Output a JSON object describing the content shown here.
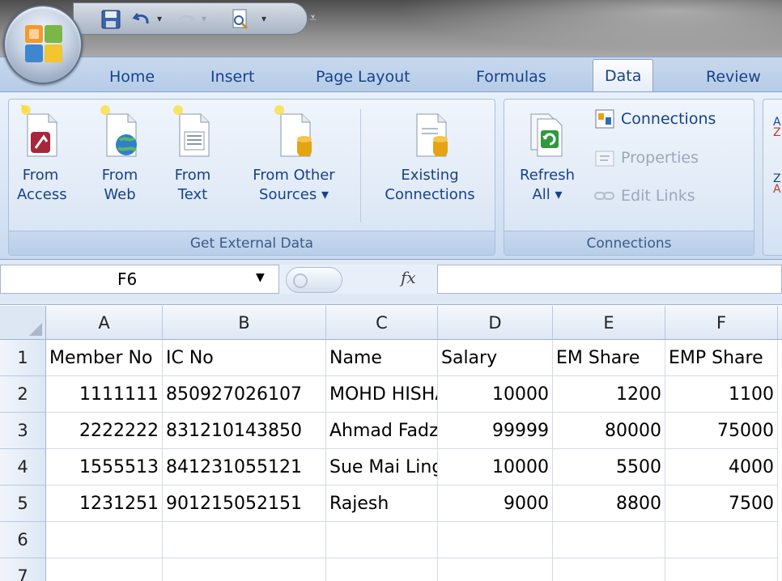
{
  "tabs": [
    "Home",
    "Insert",
    "Page Layout",
    "Formulas",
    "Data",
    "Review"
  ],
  "active_tab": "Data",
  "ribbon": {
    "get_external_data": {
      "label": "Get External Data",
      "buttons": [
        {
          "line1": "From",
          "line2": "Access"
        },
        {
          "line1": "From",
          "line2": "Web"
        },
        {
          "line1": "From",
          "line2": "Text"
        },
        {
          "line1": "From Other",
          "line2": "Sources ▾"
        },
        {
          "line1": "Existing",
          "line2": "Connections"
        }
      ]
    },
    "connections": {
      "label": "Connections",
      "refresh": {
        "line1": "Refresh",
        "line2": "All ▾"
      },
      "connections_btn": "Connections",
      "properties_btn": "Properties",
      "edit_links_btn": "Edit Links"
    },
    "sort_partial": {
      "top": "A",
      "top2": "Z",
      "bottom": "Z",
      "bottom2": "A"
    }
  },
  "formula_bar": {
    "name_box": "F6",
    "fx": "fx",
    "formula": ""
  },
  "sheet": {
    "columns": [
      "A",
      "B",
      "C",
      "D",
      "E",
      "F"
    ],
    "rows": [
      "1",
      "2",
      "3",
      "4",
      "5",
      "6",
      "7"
    ],
    "cells": [
      [
        "Member No",
        "IC No",
        "Name",
        "Salary",
        "EM Share",
        "EMP Share"
      ],
      [
        "1111111",
        "850927026107",
        "MOHD HISHAM",
        "10000",
        "1200",
        "1100"
      ],
      [
        "2222222",
        "831210143850",
        "Ahmad Fadzil",
        "99999",
        "80000",
        "75000"
      ],
      [
        "1555513",
        "841231055121",
        "Sue Mai Ling",
        "10000",
        "5500",
        "4000"
      ],
      [
        "1231251",
        "901215052151",
        "Rajesh",
        "9000",
        "8800",
        "7500"
      ],
      [
        "",
        "",
        "",
        "",
        "",
        ""
      ],
      [
        "",
        "",
        "",
        "",
        "",
        ""
      ]
    ]
  },
  "colors": {
    "tab_text": "#15428b",
    "ribbon_bg": "#dbe6f4",
    "group_label": "#3b5a86",
    "office_orange": "#f39a2b"
  }
}
